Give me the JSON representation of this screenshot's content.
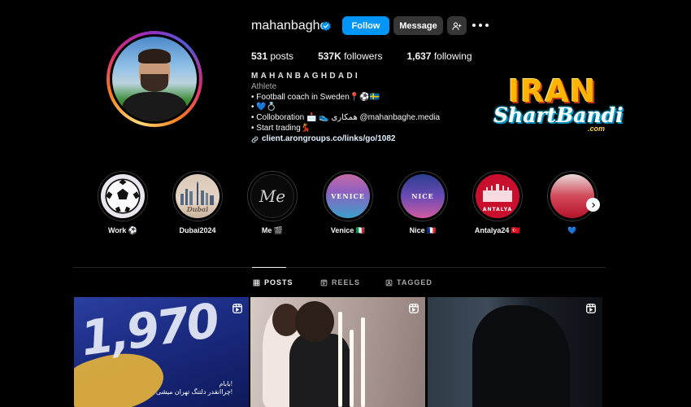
{
  "profile": {
    "username": "mahanbaghe",
    "follow_label": "Follow",
    "message_label": "Message",
    "stats": {
      "posts_count": "531",
      "posts_label": "posts",
      "followers_count": "537K",
      "followers_label": "followers",
      "following_count": "1,637",
      "following_label": "following"
    },
    "bio": {
      "name": "MAHANBAGHDADI",
      "category": "Athlete",
      "line1": "• Football coach in Sweden📍⚽🇸🇪",
      "line2": "• 💙💍",
      "line3": "• Colloboration 📩 👟 همکاری @mahanbaghe.media",
      "line4": "• Start trading💃",
      "link": "client.arongroups.co/links/go/1082"
    }
  },
  "watermark": {
    "line1": "IRAN",
    "line2": "ShartBandi",
    "line3": ".com"
  },
  "highlights": [
    {
      "label": "Work ⚽",
      "image_text": ""
    },
    {
      "label": "Dubai2024",
      "image_text": "Dubai"
    },
    {
      "label": "Me 🎬",
      "image_text": "Me"
    },
    {
      "label": "Venice 🇮🇹",
      "image_text": "VENICE"
    },
    {
      "label": "Nice 🇫🇷",
      "image_text": "NICE"
    },
    {
      "label": "Antalya24 🇹🇷",
      "image_text": "ANTALYA"
    },
    {
      "label": "💙",
      "image_text": ""
    }
  ],
  "tabs": {
    "posts": "POSTS",
    "reels": "REELS",
    "tagged": "TAGGED"
  },
  "posts": [
    {
      "overlay_text": "1,970",
      "caption_line1": "!بابام",
      "caption_line2": "!چراانقدر دلتنگ تهران میشی"
    },
    {
      "overlay_text": ""
    },
    {
      "overlay_text": ""
    }
  ],
  "colors": {
    "follow_button": "#0095f6",
    "secondary_button": "#363636",
    "verified_badge": "#0095f6",
    "background": "#000000",
    "watermark_orange": "#ffb400",
    "watermark_cyan": "#14c8f0"
  },
  "icons": [
    "verified-badge-icon",
    "add-user-icon",
    "more-options-icon",
    "link-icon",
    "grid-icon",
    "reels-icon",
    "tagged-icon",
    "chevron-right-icon",
    "reel-indicator-icon"
  ]
}
